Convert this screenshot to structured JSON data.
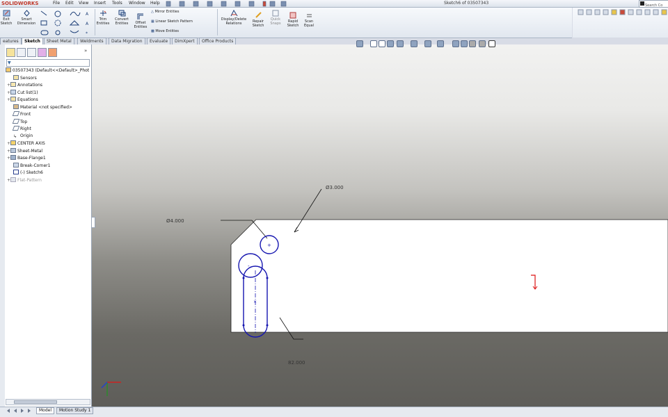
{
  "app": {
    "logo": "SOLIDWORKS",
    "doc_title": "Sketch6 of 03507343",
    "search_placeholder": "Search Co"
  },
  "menu": [
    "File",
    "Edit",
    "View",
    "Insert",
    "Tools",
    "Window",
    "Help"
  ],
  "command_manager": {
    "exit_sketch": "Exit Sketch",
    "smart_dimension": "Smart Dimension",
    "trim": "Trim Entities",
    "convert": "Convert Entities",
    "offset": "Offset Entities",
    "mirror": "Mirror Entities",
    "linear_pattern": "Linear Sketch Pattern",
    "move": "Move Entities",
    "display_delete": "Display/Delete Relations",
    "repair": "Repair Sketch",
    "quick_snaps": "Quick Snaps",
    "rapid_sketch": "Rapid Sketch",
    "scan_equal": "Scan Equal"
  },
  "tabs": [
    "eatures",
    "Sketch",
    "Sheet Metal",
    "Weldments",
    "Data Migration",
    "Evaluate",
    "DimXpert",
    "Office Products"
  ],
  "active_tab": "Sketch",
  "tree": {
    "root": "03507343  (Default<<Default>_Phot",
    "items": [
      {
        "label": "Sensors",
        "exp": ""
      },
      {
        "label": "Annotations",
        "exp": "+"
      },
      {
        "label": "Cut list(1)",
        "exp": "+"
      },
      {
        "label": "Equations",
        "exp": "+"
      },
      {
        "label": "Material <not specified>",
        "exp": ""
      },
      {
        "label": "Front",
        "exp": ""
      },
      {
        "label": "Top",
        "exp": ""
      },
      {
        "label": "Right",
        "exp": ""
      },
      {
        "label": "Origin",
        "exp": ""
      },
      {
        "label": "CENTER AXIS",
        "exp": "+"
      },
      {
        "label": "Sheet-Metal",
        "exp": "+"
      },
      {
        "label": "Base-Flange1",
        "exp": "+"
      },
      {
        "label": "Break-Corner1",
        "exp": ""
      },
      {
        "label": "(-) Sketch6",
        "exp": ""
      },
      {
        "label": "Flat-Pattern",
        "exp": "+"
      }
    ]
  },
  "dimensions": {
    "dia_small": "Ø3.000",
    "dia_large": "Ø4.000",
    "length": "82.000"
  },
  "bottom_tabs": [
    "Model",
    "Motion Study 1"
  ],
  "colors": {
    "sketch": "#1515b0",
    "logo": "#c0392b"
  }
}
